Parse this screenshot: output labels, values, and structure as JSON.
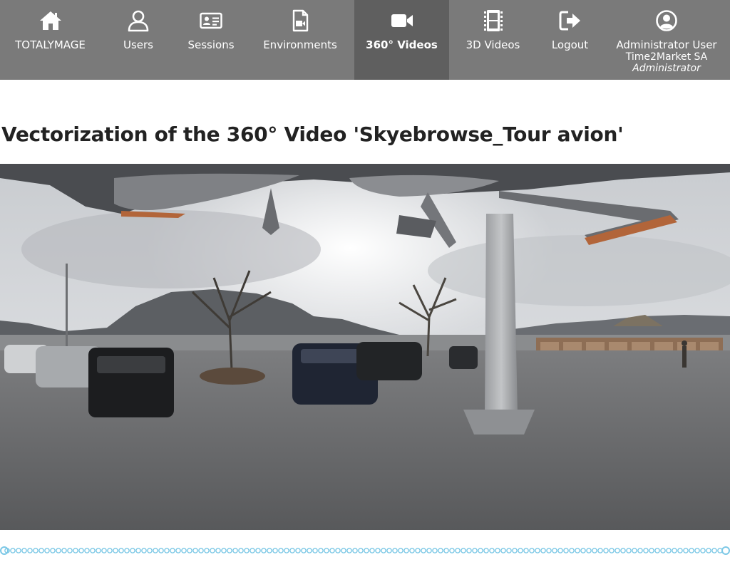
{
  "nav": {
    "items": [
      {
        "label": "TOTALYMAGE",
        "icon": "home-icon"
      },
      {
        "label": "Users",
        "icon": "user-icon"
      },
      {
        "label": "Sessions",
        "icon": "id-card-icon"
      },
      {
        "label": "Environments",
        "icon": "video-file-icon"
      },
      {
        "label": "360° Videos",
        "icon": "video-camera-icon",
        "active": true
      },
      {
        "label": "3D Videos",
        "icon": "film-strip-icon"
      },
      {
        "label": "Logout",
        "icon": "logout-icon"
      }
    ],
    "account": {
      "name": "Administrator User",
      "company": "Time2Market SA",
      "role": "Administrator",
      "icon": "user-circle-icon"
    }
  },
  "page": {
    "title": "Vectorization of the 360° Video 'Skyebrowse_Tour avion'"
  },
  "colors": {
    "nav_bg": "#7a7a7a",
    "nav_active_bg": "#5f5f5f",
    "timeline": "#7cc8e6"
  }
}
